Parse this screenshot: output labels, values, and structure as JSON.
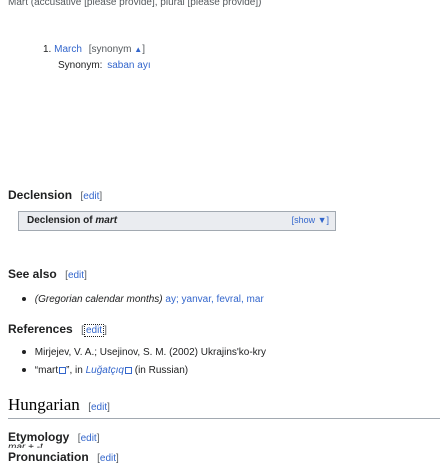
{
  "top": {
    "cut_line": "Mart (accusative [please provide], plural [please provide])",
    "item_num": "1.",
    "item_word": "March",
    "item_syn": "[synonym",
    "item_syn_icon": "▲",
    "item_syn_close": "]",
    "synonym_label": "Synonym:",
    "synonym_value": "saban ayı"
  },
  "declension": {
    "heading": "Declension",
    "edit_label": "edit",
    "table_title_prefix": "Declension of",
    "table_title_word": "mart",
    "show_label": "[show ▼]"
  },
  "see_also": {
    "heading": "See also",
    "edit_label": "edit",
    "item_prefix": "(Gregorian calendar months)",
    "item_text": "ay; yanvar, fevral, mar"
  },
  "references": {
    "heading": "References",
    "edit_label": "edit",
    "ref1": "Mirjejev, V. A.; Usejinov, S. M. (2002) Ukrajins'ko-kry",
    "ref2_prefix": "“mart",
    "ref2_mid": "”, in",
    "ref2_title": "Luğatçıq",
    "ref2_suffix": "(in Russian)"
  },
  "hungarian": {
    "heading": "Hungarian",
    "edit_label": "edit"
  },
  "etymology": {
    "heading": "Etymology",
    "edit_label": "edit",
    "text": "mar + -t"
  },
  "pronunciation": {
    "heading": "Pronunciation",
    "edit_label": "edit"
  },
  "colors": {
    "link": "#3366cc",
    "text": "#202122",
    "muted": "#54595d",
    "navbox_bg": "#eaecf0",
    "border": "#a2a9b1"
  }
}
